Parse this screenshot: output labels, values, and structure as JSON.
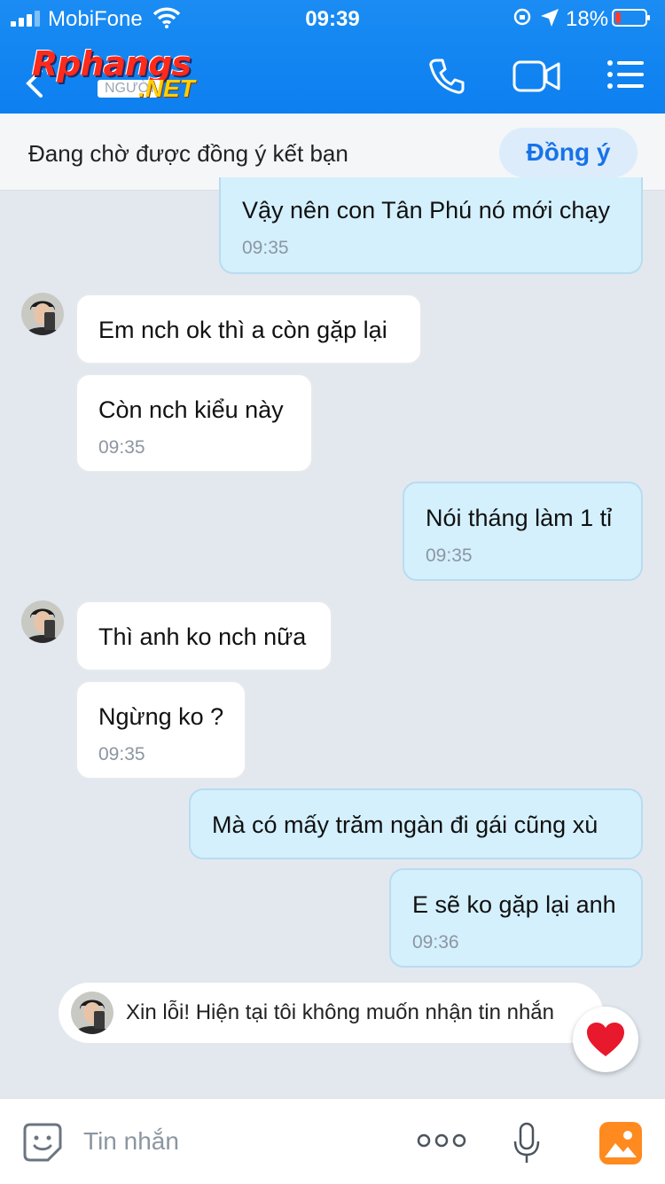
{
  "status": {
    "carrier": "MobiFone",
    "time": "09:39",
    "battery": "18%"
  },
  "logo": {
    "main": "Rphangs",
    "tag": "NGƯỜI",
    "net": ".NET"
  },
  "friend_request": {
    "text": "Đang chờ được đồng ý kết bạn",
    "accept_label": "Đồng ý"
  },
  "messages": [
    {
      "side": "sent",
      "text": "Vậy nên con Tân Phú nó mới chạy",
      "time": "09:35"
    },
    {
      "side": "recv",
      "text": "Em nch ok thì a còn gặp lại"
    },
    {
      "side": "recv",
      "text": "Còn nch kiểu này",
      "time": "09:35"
    },
    {
      "side": "sent",
      "text": "Nói tháng làm 1 tỉ",
      "time": "09:35"
    },
    {
      "side": "recv",
      "text": "Thì anh ko nch nữa"
    },
    {
      "side": "recv",
      "text": "Ngừng ko ?",
      "time": "09:35"
    },
    {
      "side": "sent",
      "text": "Mà có mấy trăm ngàn đi gái cũng xù"
    },
    {
      "side": "sent",
      "text": "E sẽ ko gặp lại anh",
      "time": "09:36"
    }
  ],
  "notice": {
    "text": "Xin lỗi! Hiện tại tôi không muốn nhận tin nhắn"
  },
  "input": {
    "placeholder": "Tin nhắn"
  },
  "colors": {
    "header_blue": "#0d7ff0",
    "sent_bubble": "#d4f0fd",
    "accept_text": "#1772e8",
    "heart": "#e8192c"
  }
}
